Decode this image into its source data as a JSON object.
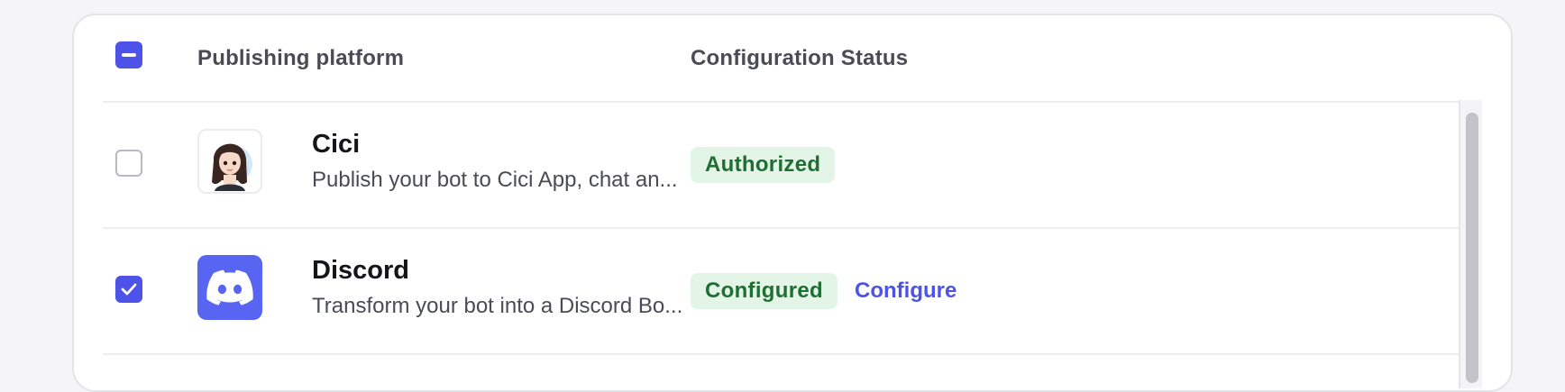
{
  "table": {
    "headers": {
      "platform": "Publishing platform",
      "status": "Configuration Status"
    },
    "select_all_state": "indeterminate",
    "rows": [
      {
        "name": "Cici",
        "description": "Publish your bot to Cici App, chat an...",
        "status": "Authorized",
        "checked": false,
        "action": ""
      },
      {
        "name": "Discord",
        "description": "Transform your bot into a Discord Bo...",
        "status": "Configured",
        "checked": true,
        "action": "Configure"
      }
    ]
  },
  "colors": {
    "accent": "#4d53e8",
    "badge_bg": "#e3f5e6",
    "badge_text": "#1f6e33",
    "discord_brand": "#5865f2"
  }
}
